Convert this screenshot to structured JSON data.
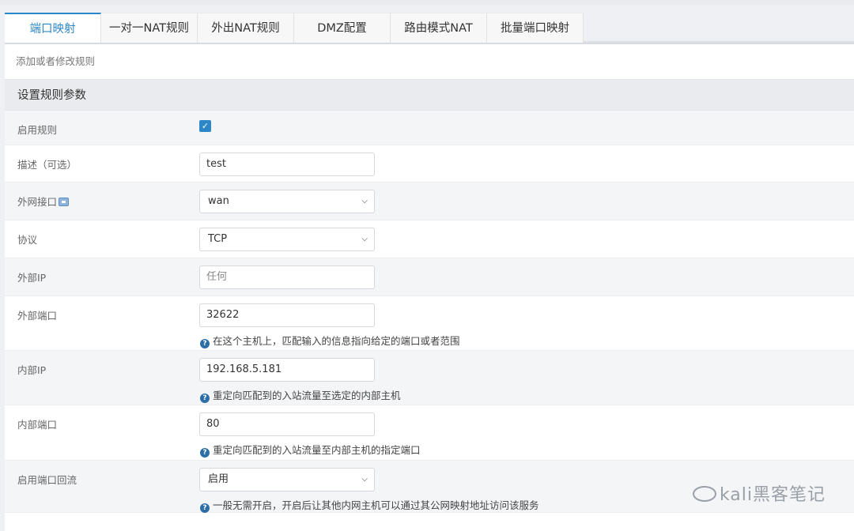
{
  "tabs": [
    {
      "label": "端口映射",
      "active": true
    },
    {
      "label": "一对一NAT规则",
      "active": false
    },
    {
      "label": "外出NAT规则",
      "active": false
    },
    {
      "label": "DMZ配置",
      "active": false
    },
    {
      "label": "路由模式NAT",
      "active": false
    },
    {
      "label": "批量端口映射",
      "active": false
    }
  ],
  "subtitle": "添加或者修改规则",
  "section_title": "设置规则参数",
  "form": {
    "enable_rule": {
      "label": "启用规则",
      "checked": true
    },
    "description": {
      "label": "描述（可选）",
      "value": "test"
    },
    "wan_interface": {
      "label": "外网接口",
      "value": "wan",
      "icon": "info-icon"
    },
    "protocol": {
      "label": "协议",
      "value": "TCP"
    },
    "external_ip": {
      "label": "外部IP",
      "placeholder": "任何"
    },
    "external_port": {
      "label": "外部端口",
      "value": "32622",
      "help": "在这个主机上，匹配输入的信息指向给定的端口或者范围"
    },
    "internal_ip": {
      "label": "内部IP",
      "value": "192.168.5.181",
      "help": "重定向匹配到的入站流量至选定的内部主机"
    },
    "internal_port": {
      "label": "内部端口",
      "value": "80",
      "help": "重定向匹配到的入站流量至内部主机的指定端口"
    },
    "loopback": {
      "label": "启用端口回流",
      "value": "启用",
      "help": "一般无需开启，开启后让其他内网主机可以通过其公网映射地址访问该服务"
    }
  },
  "watermark": "kali黑客笔记"
}
